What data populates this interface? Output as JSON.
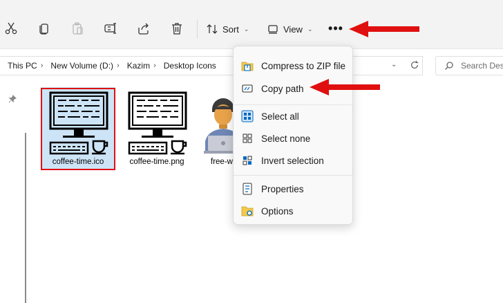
{
  "toolbar": {
    "icons": [
      "cut-icon",
      "copy-icon",
      "paste-icon",
      "rename-icon",
      "share-icon",
      "delete-icon"
    ],
    "sort_label": "Sort",
    "view_label": "View",
    "more_label": "•••"
  },
  "breadcrumb": {
    "items": [
      "This PC",
      "New Volume (D:)",
      "Kazim",
      "Desktop Icons"
    ]
  },
  "search": {
    "placeholder": "Search Des"
  },
  "files": [
    {
      "name": "coffee-time.ico",
      "selected": true
    },
    {
      "name": "coffee-time.png",
      "selected": false
    },
    {
      "name": "free-w"
    }
  ],
  "menu": {
    "items": [
      {
        "label": "Compress to ZIP file",
        "icon": "zip-folder-icon"
      },
      {
        "label": "Copy path",
        "icon": "copy-path-icon"
      },
      {
        "label": "Select all",
        "icon": "select-all-icon"
      },
      {
        "label": "Select none",
        "icon": "select-none-icon"
      },
      {
        "label": "Invert selection",
        "icon": "invert-selection-icon"
      },
      {
        "label": "Properties",
        "icon": "properties-icon"
      },
      {
        "label": "Options",
        "icon": "options-icon"
      }
    ]
  },
  "colors": {
    "accent": "#0067c0",
    "annotation_red": "#e01010",
    "selection": "#cde4f7"
  }
}
